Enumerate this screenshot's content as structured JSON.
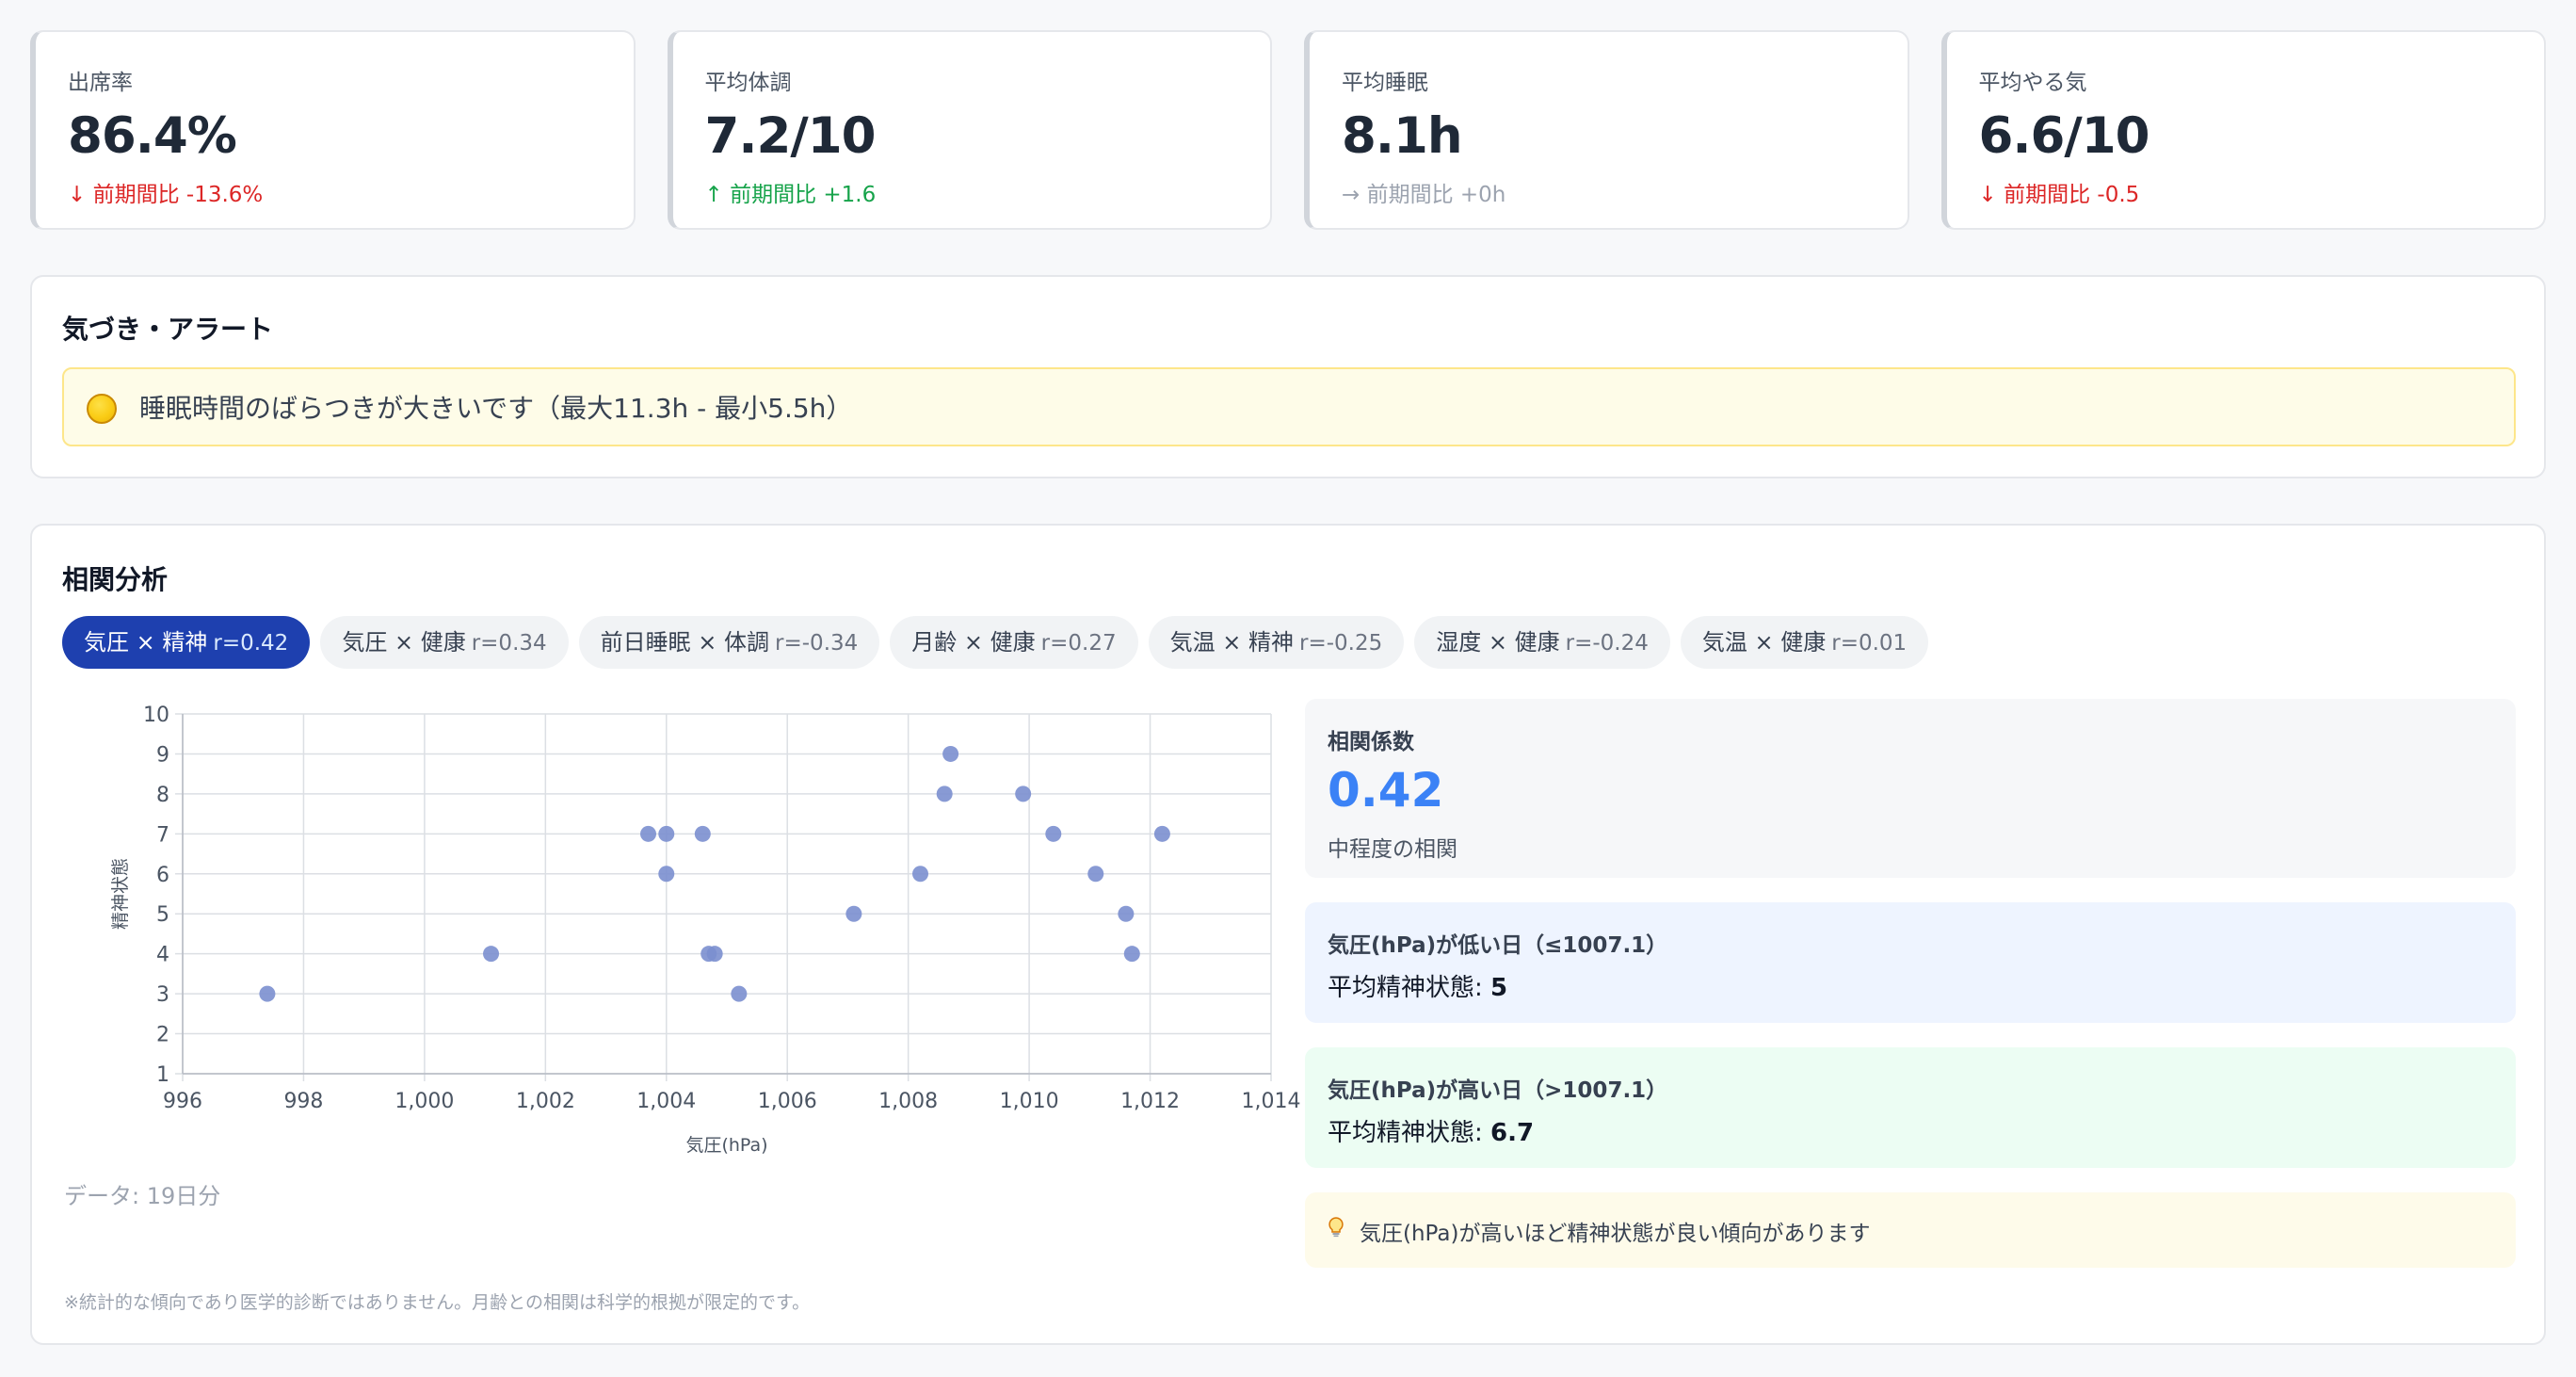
{
  "kpis": [
    {
      "label": "出席率",
      "value": "86.4%",
      "delta": "↓ 前期間比 -13.6%",
      "trend": "down"
    },
    {
      "label": "平均体調",
      "value": "7.2/10",
      "delta": "↑ 前期間比 +1.6",
      "trend": "up"
    },
    {
      "label": "平均睡眠",
      "value": "8.1h",
      "delta": "→ 前期間比 +0h",
      "trend": "flat"
    },
    {
      "label": "平均やる気",
      "value": "6.6/10",
      "delta": "↓ 前期間比 -0.5",
      "trend": "down"
    }
  ],
  "alerts": {
    "title": "気づき・アラート",
    "items": [
      {
        "icon": "yellow-circle-icon",
        "text": "睡眠時間のばらつきが大きいです（最大11.3h - 最小5.5h）"
      }
    ]
  },
  "correlation": {
    "title": "相関分析",
    "chips": [
      {
        "label": "気圧 × 精神",
        "r": "r=0.42",
        "active": true
      },
      {
        "label": "気圧 × 健康",
        "r": "r=0.34",
        "active": false
      },
      {
        "label": "前日睡眠 × 体調",
        "r": "r=-0.34",
        "active": false
      },
      {
        "label": "月齢 × 健康",
        "r": "r=0.27",
        "active": false
      },
      {
        "label": "気温 × 精神",
        "r": "r=-0.25",
        "active": false
      },
      {
        "label": "湿度 × 健康",
        "r": "r=-0.24",
        "active": false
      },
      {
        "label": "気温 × 健康",
        "r": "r=0.01",
        "active": false
      }
    ],
    "data_count": "データ: 19日分",
    "coefficient": {
      "title": "相関係数",
      "value": "0.42",
      "description": "中程度の相関"
    },
    "low_group": {
      "title": "気圧(hPa)が低い日（≤1007.1）",
      "label": "平均精神状態: ",
      "value": "5"
    },
    "high_group": {
      "title": "気圧(hPa)が高い日（>1007.1）",
      "label": "平均精神状態: ",
      "value": "6.7"
    },
    "tip": {
      "icon": "lightbulb-icon",
      "text": "気圧(hPa)が高いほど精神状態が良い傾向があります"
    },
    "disclaimer": "※統計的な傾向であり医学的診断ではありません。月齢との相関は科学的根拠が限定的です。"
  },
  "colors": {
    "accent": "#1e40af",
    "coefficient": "#3b82f6",
    "point": "#7b8fcf",
    "down": "#dc2626",
    "up": "#16a34a",
    "flat": "#9ca3af"
  },
  "chart_data": {
    "type": "scatter",
    "xlabel": "気圧(hPa)",
    "ylabel": "精神状態",
    "xlim": [
      996,
      1014
    ],
    "ylim": [
      1,
      10
    ],
    "x_ticks": [
      "996",
      "998",
      "1,000",
      "1,002",
      "1,004",
      "1,006",
      "1,008",
      "1,010",
      "1,012",
      "1,014"
    ],
    "y_ticks": [
      "1",
      "2",
      "3",
      "4",
      "5",
      "6",
      "7",
      "8",
      "9",
      "10"
    ],
    "grid": true,
    "points": [
      {
        "x": 997.4,
        "y": 3
      },
      {
        "x": 1001.1,
        "y": 4
      },
      {
        "x": 1003.7,
        "y": 7
      },
      {
        "x": 1004.0,
        "y": 7
      },
      {
        "x": 1004.0,
        "y": 6
      },
      {
        "x": 1004.6,
        "y": 7
      },
      {
        "x": 1004.7,
        "y": 4
      },
      {
        "x": 1004.8,
        "y": 4
      },
      {
        "x": 1005.2,
        "y": 3
      },
      {
        "x": 1007.1,
        "y": 5
      },
      {
        "x": 1008.2,
        "y": 6
      },
      {
        "x": 1008.6,
        "y": 8
      },
      {
        "x": 1008.7,
        "y": 9
      },
      {
        "x": 1009.9,
        "y": 8
      },
      {
        "x": 1010.4,
        "y": 7
      },
      {
        "x": 1011.1,
        "y": 6
      },
      {
        "x": 1011.6,
        "y": 5
      },
      {
        "x": 1011.7,
        "y": 4
      },
      {
        "x": 1012.2,
        "y": 7
      }
    ]
  }
}
